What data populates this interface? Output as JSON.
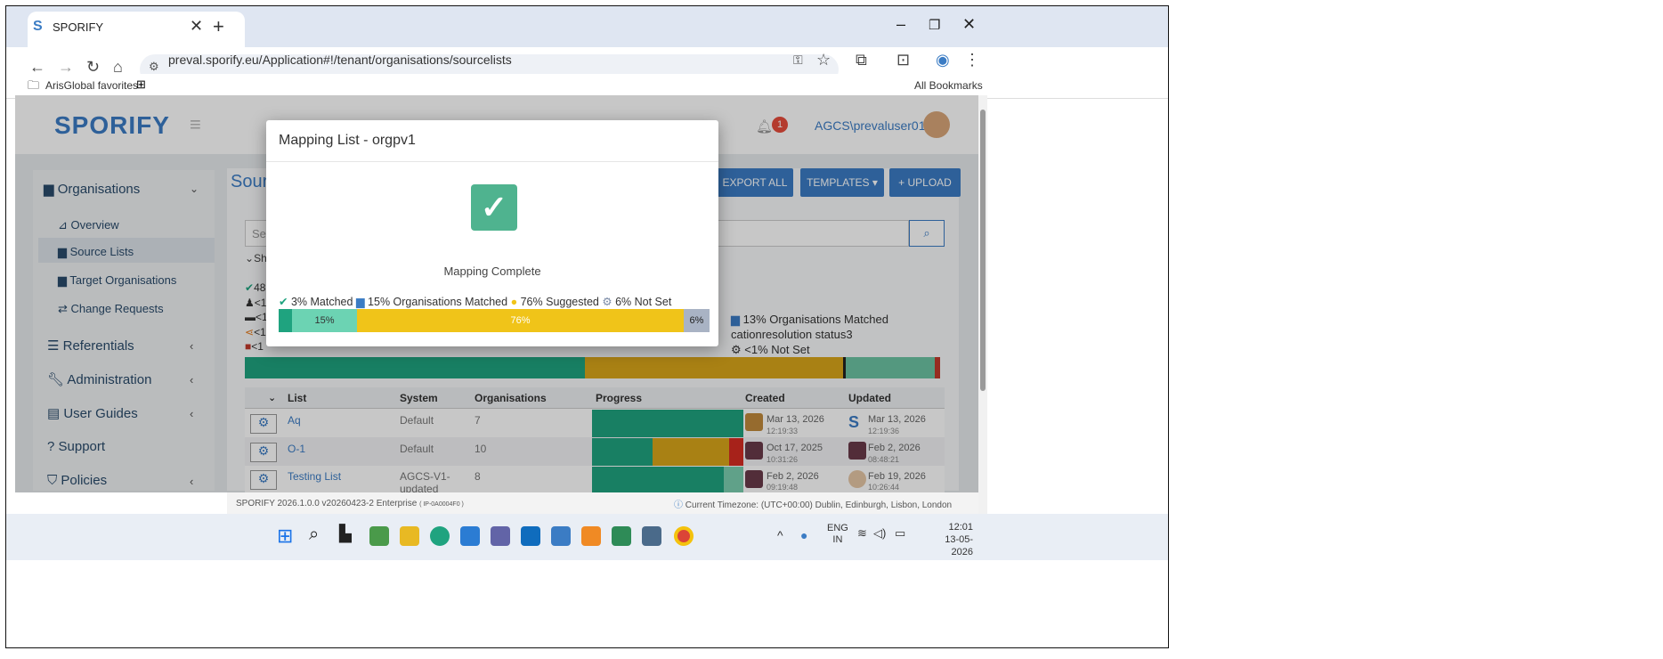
{
  "browser": {
    "tab_title": "SPORIFY",
    "url": "preval.sporify.eu/Application#!/tenant/organisations/sourcelists",
    "bookmark_left": "ArisGlobal favorites",
    "bookmark_right": "All Bookmarks"
  },
  "app": {
    "logo": "SPORIFY",
    "notification_count": "1",
    "username": "AGCS\\prevaluser01",
    "page_title_partial": "Sourc"
  },
  "sidebar": {
    "items": [
      {
        "label": "Organisations",
        "icon": "bar-chart-icon"
      },
      {
        "label": "Overview",
        "icon": "line-chart-icon"
      },
      {
        "label": "Source Lists",
        "icon": "bar-chart-icon"
      },
      {
        "label": "Target Organisations",
        "icon": "bar-chart-icon"
      },
      {
        "label": "Change Requests",
        "icon": "swap-icon"
      },
      {
        "label": "Referentials",
        "icon": "list-icon"
      },
      {
        "label": "Administration",
        "icon": "wrench-icon"
      },
      {
        "label": "User Guides",
        "icon": "book-icon"
      },
      {
        "label": "Support",
        "icon": "question-icon"
      },
      {
        "label": "Policies",
        "icon": "shield-icon"
      }
    ]
  },
  "toolbar": {
    "export_all": "EXPORT ALL",
    "templates": "TEMPLATES ▾",
    "upload": "+ UPLOAD",
    "search_placeholder": "Sea",
    "show": "Sho"
  },
  "summary": {
    "s1": "48",
    "s2": "<1",
    "s3": "<1",
    "s4": "<1",
    "s5": "<1",
    "right1": "13% Organisations Matched",
    "right2": "cationresolution status3",
    "right3": "<1% Not Set"
  },
  "table": {
    "headers": [
      "List",
      "System",
      "Organisations",
      "Progress",
      "Created",
      "Updated"
    ],
    "rows": [
      {
        "list": "Aq",
        "system": "Default",
        "orgs": "7",
        "created_date": "Mar 13, 2026",
        "created_time": "12:19:33",
        "updated_date": "Mar 13, 2026",
        "updated_time": "12:19:36"
      },
      {
        "list": "O-1",
        "system": "Default",
        "orgs": "10",
        "created_date": "Oct 17, 2025",
        "created_time": "10:31:26",
        "updated_date": "Feb 2, 2026",
        "updated_time": "08:48:21"
      },
      {
        "list": "Testing List",
        "system": "AGCS-V1-updated",
        "orgs": "8",
        "created_date": "Feb 2, 2026",
        "created_time": "09:19:48",
        "updated_date": "Feb 19, 2026",
        "updated_time": "10:26:44"
      }
    ]
  },
  "modal": {
    "title": "Mapping List - orgpv1",
    "status": "Mapping Complete",
    "legend": {
      "matched": "3% Matched",
      "orgs_matched": "15% Organisations Matched",
      "suggested": "76% Suggested",
      "not_set": "6% Not Set"
    },
    "bar_labels": {
      "orgs": "15%",
      "suggested": "76%",
      "not_set": "6%"
    },
    "bar_fractions": {
      "matched": 0.03,
      "orgs": 0.15,
      "suggested": 0.76,
      "not_set": 0.06
    }
  },
  "footer": {
    "version": "SPORIFY 2026.1.0.0 v20260423-2 Enterprise",
    "build": "( IP-0A0004F0 )",
    "timezone": "Current Timezone: (UTC+00:00) Dublin, Edinburgh, Lisbon, London"
  },
  "taskbar": {
    "lang": "ENG",
    "region": "IN",
    "time": "12:01",
    "date": "13-05-2026"
  },
  "colors": {
    "accent": "#3b7cc4",
    "matched": "#1fa37f",
    "orgs_matched": "#6cd3b3",
    "suggested": "#f0c419",
    "not_set": "#a9b3c4"
  }
}
